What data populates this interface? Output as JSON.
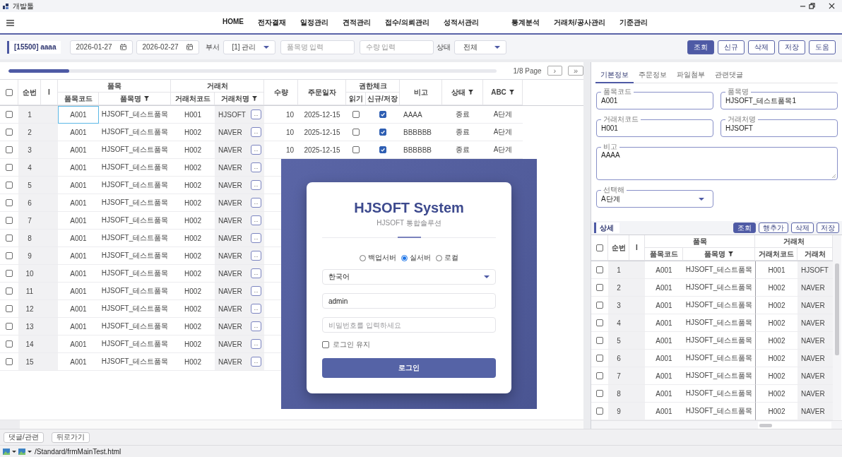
{
  "window": {
    "title": "개발툴"
  },
  "menu": {
    "items": [
      "HOME",
      "전자결재",
      "일정관리",
      "견적관리",
      "접수/의뢰관리",
      "성적서관리",
      "통계분석",
      "거래처/공사관리",
      "기준관리"
    ]
  },
  "toolbar": {
    "user_badge": "[15500] aaaa",
    "date_from": "2026-01-27",
    "date_to": "2026-02-27",
    "department": {
      "label": "부서",
      "value": "[1] 관리"
    },
    "item_name_field": {
      "placeholder": "품목명 입력"
    },
    "quantity_field": {
      "placeholder": "수량 입력"
    },
    "status": {
      "label": "상태",
      "value": "전체"
    },
    "buttons": [
      {
        "label": "조회",
        "primary": true
      },
      {
        "label": "신규",
        "primary": false
      },
      {
        "label": "삭제",
        "primary": false
      },
      {
        "label": "저장",
        "primary": false
      },
      {
        "label": "도움",
        "primary": false
      }
    ]
  },
  "grid": {
    "pager": {
      "level": 0.125,
      "page": "1/8 Page",
      "buttons": [
        "›",
        "»"
      ]
    },
    "header": [
      {
        "kind": "check",
        "checked": false
      },
      {
        "kind": "single",
        "label": "순번",
        "filter": false
      },
      {
        "kind": "single",
        "label": "I",
        "filter": false
      },
      {
        "kind": "group",
        "label": "품목",
        "columns": [
          {
            "label": "품목코드",
            "filter": false
          },
          {
            "label": "품목명",
            "filter": true
          }
        ]
      },
      {
        "kind": "group",
        "label": "거래처",
        "columns": [
          {
            "label": "거래처코드",
            "filter": false
          },
          {
            "label": "거래처명",
            "filter": true
          }
        ]
      },
      {
        "kind": "single",
        "label": "수량",
        "filter": false
      },
      {
        "kind": "single",
        "label": "주문일자",
        "filter": false
      },
      {
        "kind": "group",
        "label": "권한체크",
        "columns": [
          {
            "label": "읽기",
            "filter": false
          },
          {
            "label": "신규/저장",
            "filter": false
          }
        ]
      },
      {
        "kind": "single",
        "label": "비고",
        "filter": false
      },
      {
        "kind": "single",
        "label": "상태",
        "filter": true
      },
      {
        "kind": "single",
        "label": "ABC",
        "filter": true
      }
    ],
    "rows": [
      {
        "checked": false,
        "focused": true,
        "no": "1",
        "item_code": "A001",
        "item_name": "HJSOFT_테스트품목",
        "partner_code": "H001",
        "partner_name": "HJSOFT",
        "lookup": "...",
        "quantity": "10",
        "order_date": "2025-12-15",
        "read": false,
        "save": true,
        "note": "AAAA",
        "status": "종료",
        "abc": "A단계"
      },
      {
        "checked": false,
        "focused": false,
        "no": "2",
        "item_code": "A001",
        "item_name": "HJSOFT_테스트품목",
        "partner_code": "H002",
        "partner_name": "NAVER",
        "lookup": "...",
        "quantity": "10",
        "order_date": "2025-12-15",
        "read": false,
        "save": true,
        "note": "BBBBBB",
        "status": "종료",
        "abc": "A단계"
      },
      {
        "checked": false,
        "focused": false,
        "no": "3",
        "item_code": "A001",
        "item_name": "HJSOFT_테스트품목",
        "partner_code": "H002",
        "partner_name": "NAVER",
        "lookup": "...",
        "quantity": "10",
        "order_date": "2025-12-15",
        "read": false,
        "save": true,
        "note": "BBBBBB",
        "status": "종료",
        "abc": "A단계"
      },
      {
        "checked": false,
        "focused": false,
        "no": "4",
        "item_code": "A001",
        "item_name": "HJSOFT_테스트품목",
        "partner_code": "H002",
        "partner_name": "NAVER",
        "lookup": "..."
      },
      {
        "checked": false,
        "focused": false,
        "no": "5",
        "item_code": "A001",
        "item_name": "HJSOFT_테스트품목",
        "partner_code": "H002",
        "partner_name": "NAVER",
        "lookup": "..."
      },
      {
        "checked": false,
        "focused": false,
        "no": "6",
        "item_code": "A001",
        "item_name": "HJSOFT_테스트품목",
        "partner_code": "H002",
        "partner_name": "NAVER",
        "lookup": "..."
      },
      {
        "checked": false,
        "focused": false,
        "no": "7",
        "item_code": "A001",
        "item_name": "HJSOFT_테스트품목",
        "partner_code": "H002",
        "partner_name": "NAVER",
        "lookup": "..."
      },
      {
        "checked": false,
        "focused": false,
        "no": "8",
        "item_code": "A001",
        "item_name": "HJSOFT_테스트품목",
        "partner_code": "H002",
        "partner_name": "NAVER",
        "lookup": "..."
      },
      {
        "checked": false,
        "focused": false,
        "no": "9",
        "item_code": "A001",
        "item_name": "HJSOFT_테스트품목",
        "partner_code": "H002",
        "partner_name": "NAVER",
        "lookup": "..."
      },
      {
        "checked": false,
        "focused": false,
        "no": "10",
        "item_code": "A001",
        "item_name": "HJSOFT_테스트품목",
        "partner_code": "H002",
        "partner_name": "NAVER",
        "lookup": "..."
      },
      {
        "checked": false,
        "focused": false,
        "no": "11",
        "item_code": "A001",
        "item_name": "HJSOFT_테스트품목",
        "partner_code": "H002",
        "partner_name": "NAVER",
        "lookup": "..."
      },
      {
        "checked": false,
        "focused": false,
        "no": "12",
        "item_code": "A001",
        "item_name": "HJSOFT_테스트품목",
        "partner_code": "H002",
        "partner_name": "NAVER",
        "lookup": "..."
      },
      {
        "checked": false,
        "focused": false,
        "no": "13",
        "item_code": "A001",
        "item_name": "HJSOFT_테스트품목",
        "partner_code": "H002",
        "partner_name": "NAVER",
        "lookup": "..."
      },
      {
        "checked": false,
        "focused": false,
        "no": "14",
        "item_code": "A001",
        "item_name": "HJSOFT_테스트품목",
        "partner_code": "H002",
        "partner_name": "NAVER",
        "lookup": "..."
      },
      {
        "checked": false,
        "focused": false,
        "no": "15",
        "item_code": "A001",
        "item_name": "HJSOFT_테스트품목",
        "partner_code": "H002",
        "partner_name": "NAVER",
        "lookup": "..."
      }
    ]
  },
  "detail": {
    "tabs": [
      {
        "label": "기본정보",
        "selected": true
      },
      {
        "label": "주문정보",
        "selected": false
      },
      {
        "label": "파일첨부",
        "selected": false
      },
      {
        "label": "관련댓글",
        "selected": false
      }
    ],
    "fields": [
      {
        "kind": "input",
        "label": "품목코드",
        "value": "A001"
      },
      {
        "kind": "input",
        "label": "품목명",
        "value": "HJSOFT_테스트품목1"
      },
      {
        "kind": "input",
        "label": "거래처코드",
        "value": "H001"
      },
      {
        "kind": "input",
        "label": "거래처명",
        "value": "HJSOFT"
      },
      {
        "kind": "textarea",
        "label": "비고",
        "value": "AAAA"
      },
      {
        "kind": "select",
        "label": "선택해",
        "value": "A단계"
      }
    ],
    "section": {
      "title": "상세",
      "buttons": [
        {
          "label": "조회",
          "primary": true
        },
        {
          "label": "행추가",
          "primary": false
        },
        {
          "label": "삭제",
          "primary": false
        },
        {
          "label": "저장",
          "primary": false
        }
      ]
    },
    "table": {
      "header": [
        {
          "kind": "check",
          "checked": false
        },
        {
          "kind": "single",
          "label": "순번",
          "filter": false
        },
        {
          "kind": "single",
          "label": "I",
          "filter": false
        },
        {
          "kind": "group",
          "label": "품목",
          "columns": [
            {
              "label": "품목코드",
              "filter": false
            },
            {
              "label": "품목명",
              "filter": true
            }
          ]
        },
        {
          "kind": "group",
          "label": "거래처",
          "columns": [
            {
              "label": "거래처코드",
              "filter": false
            },
            {
              "label": "거래처",
              "filter": false
            }
          ]
        }
      ],
      "rows": [
        {
          "checked": false,
          "no": "1",
          "item_code": "A001",
          "item_name": "HJSOFT_테스트품목",
          "partner_code": "H001",
          "partner_name": "HJSOFT"
        },
        {
          "checked": false,
          "no": "2",
          "item_code": "A001",
          "item_name": "HJSOFT_테스트품목",
          "partner_code": "H002",
          "partner_name": "NAVER"
        },
        {
          "checked": false,
          "no": "3",
          "item_code": "A001",
          "item_name": "HJSOFT_테스트품목",
          "partner_code": "H002",
          "partner_name": "NAVER"
        },
        {
          "checked": false,
          "no": "4",
          "item_code": "A001",
          "item_name": "HJSOFT_테스트품목",
          "partner_code": "H002",
          "partner_name": "NAVER"
        },
        {
          "checked": false,
          "no": "5",
          "item_code": "A001",
          "item_name": "HJSOFT_테스트품목",
          "partner_code": "H002",
          "partner_name": "NAVER"
        },
        {
          "checked": false,
          "no": "6",
          "item_code": "A001",
          "item_name": "HJSOFT_테스트품목",
          "partner_code": "H002",
          "partner_name": "NAVER"
        },
        {
          "checked": false,
          "no": "7",
          "item_code": "A001",
          "item_name": "HJSOFT_테스트품목",
          "partner_code": "H002",
          "partner_name": "NAVER"
        },
        {
          "checked": false,
          "no": "8",
          "item_code": "A001",
          "item_name": "HJSOFT_테스트품목",
          "partner_code": "H002",
          "partner_name": "NAVER"
        },
        {
          "checked": false,
          "no": "9",
          "item_code": "A001",
          "item_name": "HJSOFT_테스트품목",
          "partner_code": "H002",
          "partner_name": "NAVER"
        }
      ]
    }
  },
  "login_dialog": {
    "title": "HJSOFT System",
    "subtitle": "HJSOFT 통합솔루션",
    "servers": [
      {
        "label": "백업서버",
        "selected": false
      },
      {
        "label": "실서버",
        "selected": true
      },
      {
        "label": "로컬",
        "selected": false
      }
    ],
    "language": "한국어",
    "user": {
      "value": "admin"
    },
    "password": {
      "placeholder": "비밀번호를 입력하세요"
    },
    "remember": {
      "label": "로그인 유지",
      "checked": false
    },
    "submit": "로그인"
  },
  "footer": {
    "buttons": [
      "댓글/관련",
      "뒤로가기"
    ]
  },
  "status_bar": {
    "path": "/Standard/frmMainTest.html"
  }
}
